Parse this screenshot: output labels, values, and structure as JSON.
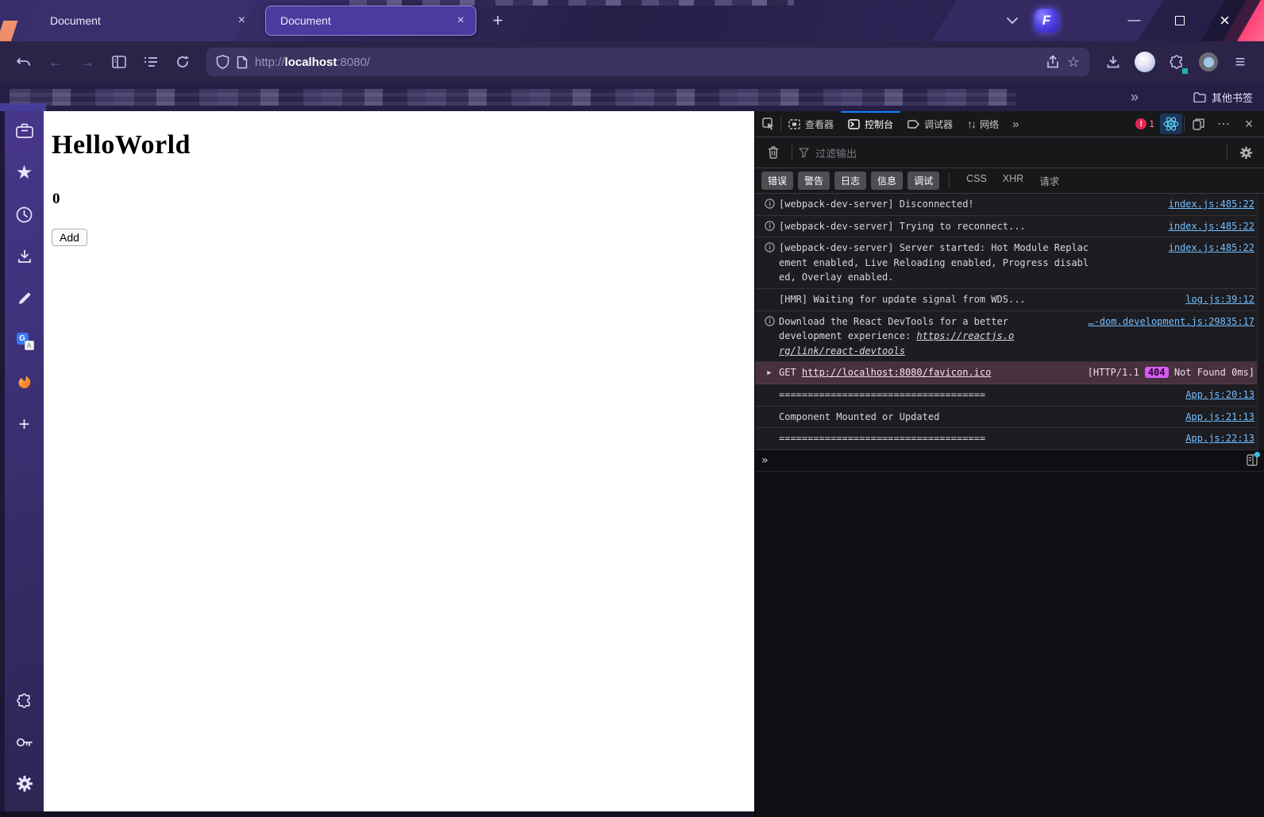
{
  "window": {
    "tabs": [
      {
        "title": "Document",
        "active": false
      },
      {
        "title": "Document",
        "active": true
      }
    ],
    "controls": {
      "minimize": "—",
      "close": "×"
    }
  },
  "icons": {
    "new_tab": "+",
    "tab_close": "×",
    "back": "←",
    "forward": "→",
    "overflow_chevron": "»",
    "hamburger": "≡",
    "bookmark_star_outline": "☆",
    "sidebar_star_filled": "★",
    "sidebar_plus": "+",
    "network_arrows": "↑↓",
    "devtools_more_tabs": "»",
    "meatballs": "⋯",
    "devtools_close": "×",
    "console_prompt": "»",
    "expand_arrow": "▶",
    "translate_g": "G",
    "translate_a": "A",
    "floorp_f": "F"
  },
  "navbar": {
    "url": {
      "scheme": "http://",
      "host": "localhost",
      "rest": ":8080/"
    }
  },
  "bookmarks": {
    "other_label": "其他书签"
  },
  "page": {
    "heading": "HelloWorld",
    "counter": "0",
    "add_button_label": "Add"
  },
  "devtools": {
    "tabs": [
      {
        "label": "查看器",
        "active": false
      },
      {
        "label": "控制台",
        "active": true
      },
      {
        "label": "调试器",
        "active": false
      },
      {
        "label": "网络",
        "active": false
      }
    ],
    "error_count": "1",
    "filter_placeholder": "过滤输出",
    "level_filters": [
      "错误",
      "警告",
      "日志",
      "信息",
      "调试"
    ],
    "type_filters": [
      "CSS",
      "XHR",
      "请求"
    ],
    "messages": [
      {
        "type": "info",
        "text": "[webpack-dev-server] Disconnected!",
        "source": "index.js:485:22"
      },
      {
        "type": "info",
        "text": "[webpack-dev-server] Trying to reconnect...",
        "source": "index.js:485:22"
      },
      {
        "type": "info",
        "text": "[webpack-dev-server] Server started: Hot Module Replacement enabled, Live Reloading enabled, Progress disabled, Overlay enabled.",
        "source": "index.js:485:22"
      },
      {
        "type": "log",
        "text": "[HMR] Waiting for update signal from WDS...",
        "source": "log.js:39:12"
      },
      {
        "type": "info",
        "text": "Download the React DevTools for a better development experience: ",
        "link": "https://reactjs.org/link/react-devtools",
        "source": "…-dom.development.js:29835:17"
      },
      {
        "type": "network-error",
        "method": "GET",
        "url": "http://localhost:8080/favicon.ico",
        "status_open": "[HTTP/1.1",
        "status_code": "404",
        "status_rest": "Not Found 0ms]"
      },
      {
        "type": "log",
        "text": "====================================",
        "source": "App.js:20:13"
      },
      {
        "type": "log",
        "text": "Component Mounted or Updated",
        "source": "App.js:21:13"
      },
      {
        "type": "log",
        "text": "====================================",
        "source": "App.js:22:13"
      }
    ]
  },
  "colors": {
    "accent_blue": "#0a84ff",
    "link_blue": "#75bfff",
    "badge_purple": "#d75cf4",
    "error_red": "#e22850",
    "active_tab_purple": "#4b3b9e"
  }
}
